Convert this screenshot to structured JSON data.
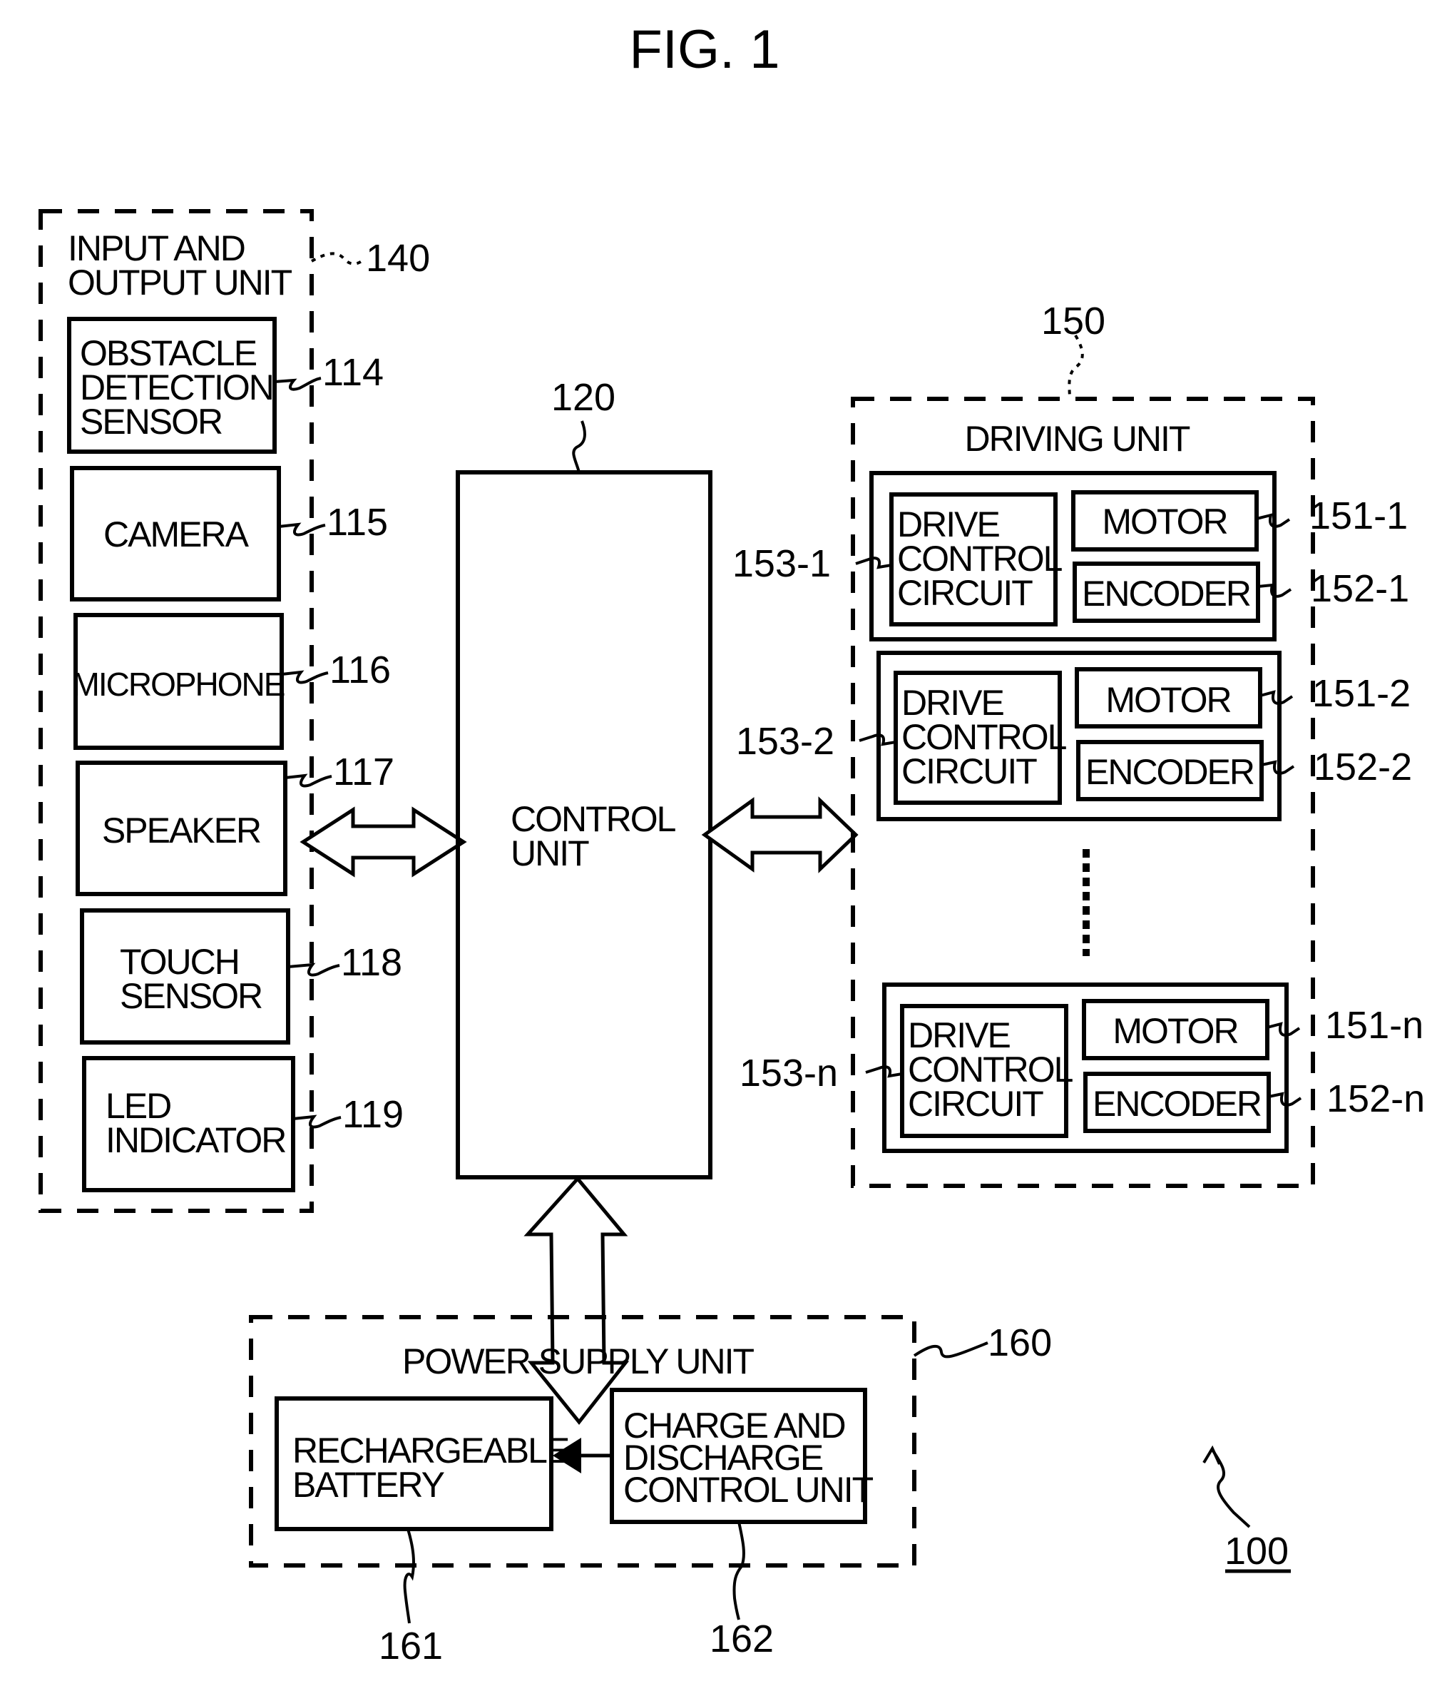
{
  "figure": {
    "title": "FIG. 1",
    "reference": "100"
  },
  "io_unit": {
    "title_line1": "INPUT AND",
    "title_line2": "OUTPUT UNIT",
    "ref": "140",
    "components": [
      {
        "lines": [
          "OBSTACLE",
          "DETECTION",
          "SENSOR"
        ],
        "ref": "114"
      },
      {
        "lines": [
          "CAMERA"
        ],
        "ref": "115"
      },
      {
        "lines": [
          "MICROPHONE"
        ],
        "ref": "116"
      },
      {
        "lines": [
          "SPEAKER"
        ],
        "ref": "117"
      },
      {
        "lines": [
          "TOUCH",
          "SENSOR"
        ],
        "ref": "118"
      },
      {
        "lines": [
          "LED",
          "INDICATOR"
        ],
        "ref": "119"
      }
    ]
  },
  "control_unit": {
    "line1": "CONTROL",
    "line2": "UNIT",
    "ref": "120"
  },
  "driving_unit": {
    "title": "DRIVING UNIT",
    "ref": "150",
    "modules": [
      {
        "drive_lines": [
          "DRIVE",
          "CONTROL",
          "CIRCUIT"
        ],
        "motor": "MOTOR",
        "encoder": "ENCODER",
        "drive_ref": "153-1",
        "motor_ref": "151-1",
        "encoder_ref": "152-1"
      },
      {
        "drive_lines": [
          "DRIVE",
          "CONTROL",
          "CIRCUIT"
        ],
        "motor": "MOTOR",
        "encoder": "ENCODER",
        "drive_ref": "153-2",
        "motor_ref": "151-2",
        "encoder_ref": "152-2"
      },
      {
        "drive_lines": [
          "DRIVE",
          "CONTROL",
          "CIRCUIT"
        ],
        "motor": "MOTOR",
        "encoder": "ENCODER",
        "drive_ref": "153-n",
        "motor_ref": "151-n",
        "encoder_ref": "152-n"
      }
    ],
    "ellipsis": "vertical-dots"
  },
  "power_unit": {
    "title": "POWER SUPPLY UNIT",
    "ref": "160",
    "battery": {
      "lines": [
        "RECHARGEABLE",
        "BATTERY"
      ],
      "ref": "161"
    },
    "charger": {
      "lines": [
        "CHARGE AND",
        "DISCHARGE",
        "CONTROL UNIT"
      ],
      "ref": "162"
    }
  },
  "connections": [
    {
      "from": "INPUT AND OUTPUT UNIT",
      "to": "CONTROL UNIT",
      "type": "bidirectional"
    },
    {
      "from": "CONTROL UNIT",
      "to": "DRIVING UNIT",
      "type": "bidirectional"
    },
    {
      "from": "CONTROL UNIT",
      "to": "POWER SUPPLY UNIT",
      "type": "bidirectional"
    },
    {
      "from": "CHARGE AND DISCHARGE CONTROL UNIT",
      "to": "RECHARGEABLE BATTERY",
      "type": "unidirectional"
    }
  ]
}
